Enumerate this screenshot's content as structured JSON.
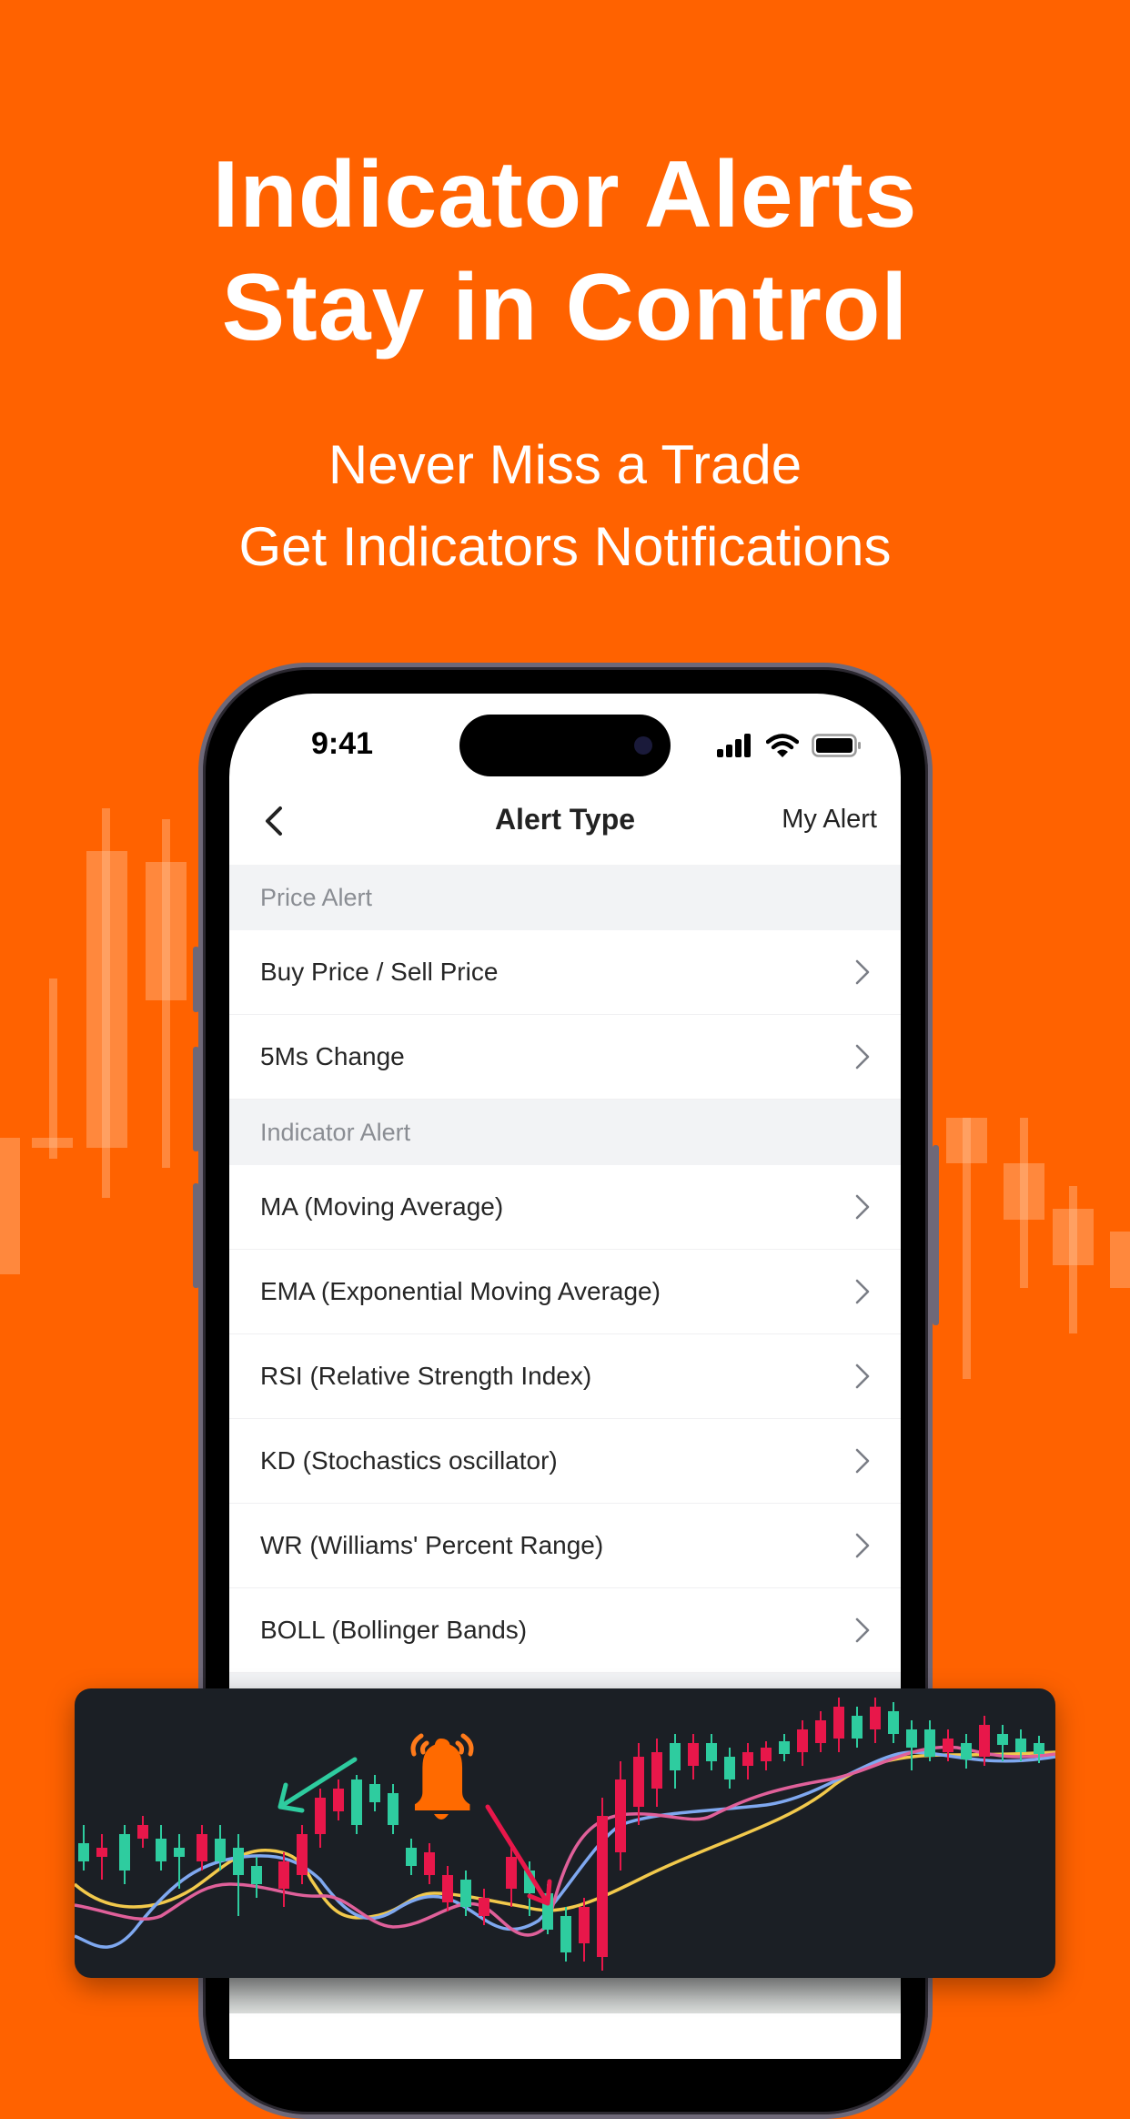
{
  "promo": {
    "headline_line1": "Indicator Alerts",
    "headline_line2": "Stay in Control",
    "subtitle_line1": "Never Miss a Trade",
    "subtitle_line2": "Get Indicators Notifications"
  },
  "colors": {
    "background": "#FF6200",
    "accent": "#FF6A00",
    "up_candle": "#2ECC9F",
    "down_candle": "#E8174A",
    "line_yellow": "#F2C94C",
    "line_blue": "#7FA8F0",
    "line_pink": "#E0609A"
  },
  "status_bar": {
    "time": "9:41",
    "icons": [
      "cellular-signal-icon",
      "wifi-icon",
      "battery-icon"
    ]
  },
  "nav": {
    "back_icon": "chevron-left-icon",
    "title": "Alert Type",
    "right_action": "My Alert"
  },
  "sections": [
    {
      "header": "Price Alert",
      "items": [
        {
          "label": "Buy Price / Sell Price"
        },
        {
          "label": "5Ms Change"
        }
      ]
    },
    {
      "header": "Indicator Alert",
      "items": [
        {
          "label": "MA (Moving Average)"
        },
        {
          "label": "EMA (Exponential Moving Average)"
        },
        {
          "label": "RSI (Relative Strength Index)"
        },
        {
          "label": "KD (Stochastics oscillator)"
        },
        {
          "label": "WR (Williams' Percent Range)"
        },
        {
          "label": "BOLL (Bollinger Bands)"
        }
      ]
    }
  ],
  "chart_card": {
    "icon": "bell-ringing-icon",
    "annotations": [
      "green-arrow-pointing-to-local-peak",
      "red-arrow-pointing-to-breakout-candle"
    ]
  }
}
